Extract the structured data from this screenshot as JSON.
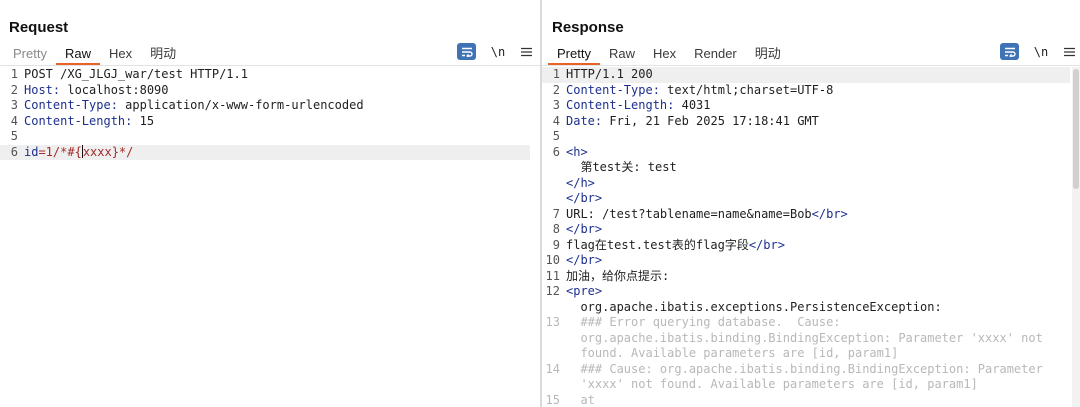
{
  "request": {
    "title": "Request",
    "tabs": [
      "Pretty",
      "Raw",
      "Hex",
      "明动"
    ],
    "active_tab": "Raw",
    "newline_label": "\\n",
    "lines": [
      {
        "n": "1",
        "parts": [
          {
            "t": "POST /XG_JLGJ_war/test HTTP/1.1",
            "c": "v"
          }
        ]
      },
      {
        "n": "2",
        "parts": [
          {
            "t": "Host:",
            "c": "k"
          },
          {
            "t": " localhost:8090",
            "c": "v"
          }
        ]
      },
      {
        "n": "3",
        "parts": [
          {
            "t": "Content-Type:",
            "c": "k"
          },
          {
            "t": " application/x-www-form-urlencoded",
            "c": "v"
          }
        ]
      },
      {
        "n": "4",
        "parts": [
          {
            "t": "Content-Length:",
            "c": "k"
          },
          {
            "t": " 15",
            "c": "v"
          }
        ]
      },
      {
        "n": "5",
        "parts": []
      },
      {
        "n": "6",
        "hl": true,
        "parts": [
          {
            "t": "id",
            "c": "param-name"
          },
          {
            "t": "=1/*#{",
            "c": "param-val"
          },
          {
            "t": "|cursor|",
            "c": "cursor"
          },
          {
            "t": "xxxx}*/",
            "c": "param-val"
          }
        ]
      }
    ]
  },
  "response": {
    "title": "Response",
    "tabs": [
      "Pretty",
      "Raw",
      "Hex",
      "Render",
      "明动"
    ],
    "active_tab": "Pretty",
    "newline_label": "\\n",
    "lines": [
      {
        "n": "1",
        "hl": true,
        "parts": [
          {
            "t": "HTTP/1.1 200",
            "c": "v"
          }
        ]
      },
      {
        "n": "2",
        "parts": [
          {
            "t": "Content-Type:",
            "c": "k"
          },
          {
            "t": " text/html;charset=UTF-8",
            "c": "v"
          }
        ]
      },
      {
        "n": "3",
        "parts": [
          {
            "t": "Content-Length:",
            "c": "k"
          },
          {
            "t": " 4031",
            "c": "v"
          }
        ]
      },
      {
        "n": "4",
        "parts": [
          {
            "t": "Date:",
            "c": "k"
          },
          {
            "t": " Fri, 21 Feb 2025 17:18:41 GMT",
            "c": "v"
          }
        ]
      },
      {
        "n": "5",
        "parts": []
      },
      {
        "n": "6",
        "parts": [
          {
            "t": "<h>",
            "c": "tag"
          }
        ]
      },
      {
        "n": "",
        "parts": [
          {
            "t": "  第test关: test",
            "c": "v"
          }
        ]
      },
      {
        "n": "",
        "parts": [
          {
            "t": "</h>",
            "c": "tag"
          }
        ]
      },
      {
        "n": "",
        "parts": [
          {
            "t": "</br>",
            "c": "tag"
          }
        ]
      },
      {
        "n": "7",
        "parts": [
          {
            "t": "URL: /test?tablename=name&name=Bob",
            "c": "v"
          },
          {
            "t": "</br>",
            "c": "tag"
          }
        ]
      },
      {
        "n": "8",
        "parts": [
          {
            "t": "</br>",
            "c": "tag"
          }
        ]
      },
      {
        "n": "9",
        "parts": [
          {
            "t": "flag在test.test表的flag字段",
            "c": "v"
          },
          {
            "t": "</br>",
            "c": "tag"
          }
        ]
      },
      {
        "n": "10",
        "parts": [
          {
            "t": "</br>",
            "c": "tag"
          }
        ]
      },
      {
        "n": "11",
        "parts": [
          {
            "t": "加油，给你点提示:",
            "c": "v"
          }
        ]
      },
      {
        "n": "12",
        "parts": [
          {
            "t": "<pre>",
            "c": "tag"
          }
        ]
      },
      {
        "n": "",
        "parts": [
          {
            "t": "  org.apache.ibatis.exceptions.PersistenceException:",
            "c": "v"
          }
        ]
      },
      {
        "n": "13",
        "faded": true,
        "parts": [
          {
            "t": "  ### Error querying database.  Cause:",
            "c": "faded"
          }
        ]
      },
      {
        "n": "",
        "faded": true,
        "parts": [
          {
            "t": "  org.apache.ibatis.binding.BindingException: Parameter 'xxxx' not",
            "c": "faded"
          }
        ]
      },
      {
        "n": "",
        "faded": true,
        "parts": [
          {
            "t": "  found. Available parameters are [id, param1]",
            "c": "faded"
          }
        ]
      },
      {
        "n": "14",
        "faded": true,
        "parts": [
          {
            "t": "  ### Cause: org.apache.ibatis.binding.BindingException: Parameter",
            "c": "faded"
          }
        ]
      },
      {
        "n": "",
        "faded": true,
        "parts": [
          {
            "t": "  'xxxx' not found. Available parameters are [id, param1]",
            "c": "faded"
          }
        ]
      },
      {
        "n": "15",
        "faded": true,
        "parts": [
          {
            "t": "  at",
            "c": "faded"
          }
        ]
      }
    ]
  },
  "icons": {
    "wrap": "wrap-lines-icon",
    "menu": "hamburger-menu-icon",
    "layout_side_by_side": "columns-layout-icon",
    "layout_stacked": "rows-layout-icon",
    "layout_tabs": "single-pane-layout-icon"
  },
  "colors": {
    "accent_tab_underline": "#e8632a",
    "button_blue": "#3f73b5",
    "header_key": "#1d2f8f",
    "param_value": "#a52a2a"
  }
}
